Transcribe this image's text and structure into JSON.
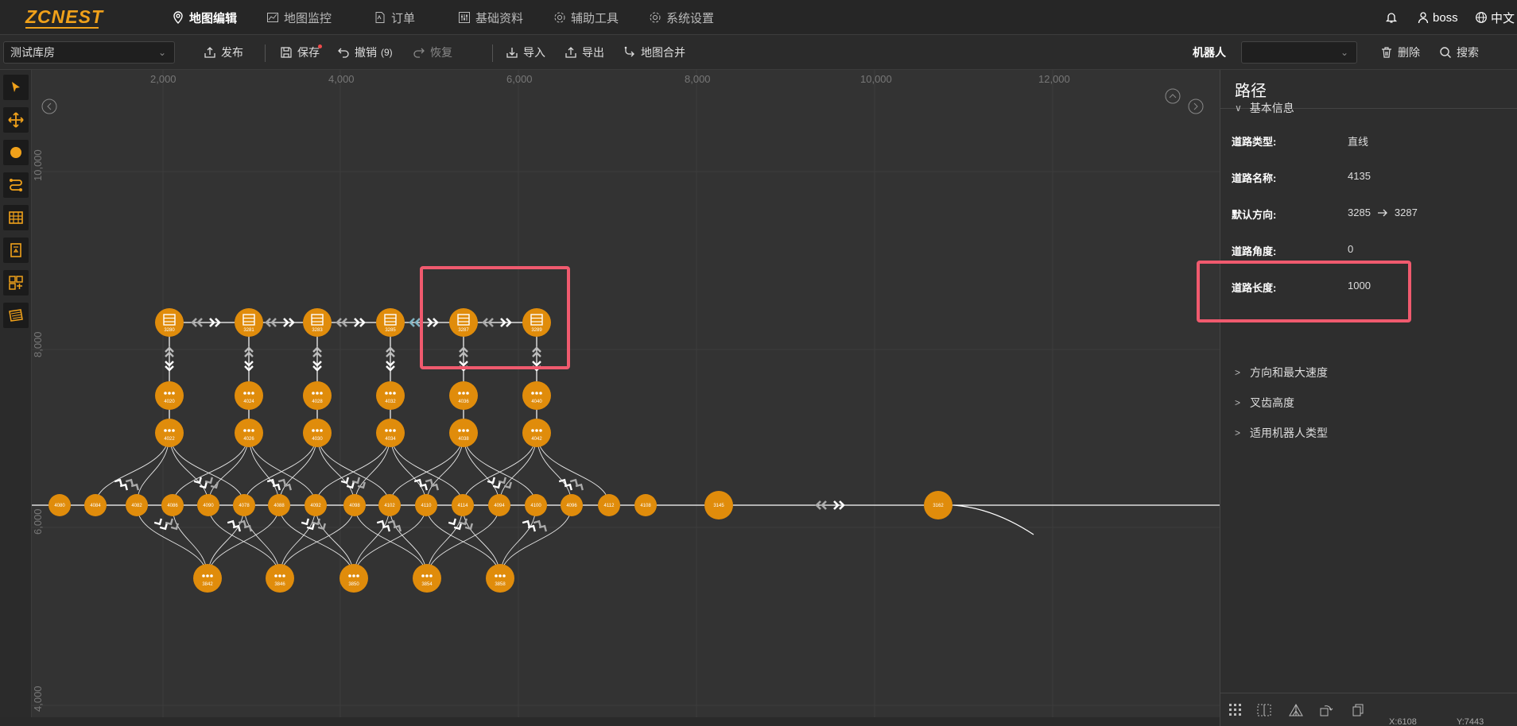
{
  "app": {
    "logo": "ZCNEST",
    "nav": [
      {
        "label": "地图编辑",
        "icon": "map-pin-icon",
        "active": true
      },
      {
        "label": "地图监控",
        "icon": "chart-icon",
        "active": false
      },
      {
        "label": "订单",
        "icon": "document-icon",
        "active": false
      },
      {
        "label": "基础资料",
        "icon": "sliders-icon",
        "active": false
      },
      {
        "label": "辅助工具",
        "icon": "gear-icon",
        "active": false
      },
      {
        "label": "系统设置",
        "icon": "gear-icon",
        "active": false
      }
    ],
    "user": "boss",
    "language": "中文"
  },
  "toolbar": {
    "warehouse": "测试库房",
    "publish": "发布",
    "save": "保存",
    "undo": "撤销",
    "undo_count": "(9)",
    "redo": "恢复",
    "import": "导入",
    "export": "导出",
    "merge": "地图合并",
    "robot_label": "机器人",
    "robot_value": "",
    "delete": "删除",
    "search": "搜索"
  },
  "tools": [
    "select-tool-icon",
    "move-tool-icon",
    "point-tool-icon",
    "path-tool-icon",
    "shelf-tool-icon",
    "elevator-tool-icon",
    "area-tool-icon",
    "layer-tool-icon"
  ],
  "canvas": {
    "x_ticks": [
      "2,000",
      "4,000",
      "6,000",
      "8,000",
      "10,000",
      "12,000"
    ],
    "y_ticks": [
      "10,000",
      "8,000",
      "6,000",
      "4,000"
    ],
    "top_nodes": [
      "3280",
      "3281",
      "3283",
      "3285",
      "3287",
      "3289"
    ],
    "mid1_nodes": [
      "4020",
      "4024",
      "4028",
      "4032",
      "4036",
      "4040"
    ],
    "mid2_nodes": [
      "4022",
      "4026",
      "4030",
      "4034",
      "4038",
      "4042"
    ],
    "line_nodes": [
      "4080",
      "4084",
      "4082",
      "4086",
      "4090",
      "4078",
      "4088",
      "4092",
      "4098",
      "4102",
      "4110",
      "4114",
      "4094",
      "4100",
      "4096",
      "4112",
      "4108",
      "3145",
      "3162"
    ],
    "bottom_nodes": [
      "3842",
      "3846",
      "3850",
      "3854",
      "3858"
    ],
    "cursor_x": "X:6108",
    "cursor_y": "Y:7443"
  },
  "panel": {
    "title": "路径",
    "section_basic": "基本信息",
    "fields": [
      {
        "label": "道路类型:",
        "value": "直线"
      },
      {
        "label": "道路名称:",
        "value": "4135"
      },
      {
        "label": "默认方向:",
        "from": "3285",
        "to": "3287"
      },
      {
        "label": "道路角度:",
        "value": "0"
      },
      {
        "label": "道路长度:",
        "value": "1000"
      }
    ],
    "sections": [
      "方向和最大速度",
      "叉齿高度",
      "适用机器人类型"
    ]
  },
  "colors": {
    "accent": "#e08c0b",
    "highlight": "#f05a6e",
    "bg": "#333333"
  }
}
